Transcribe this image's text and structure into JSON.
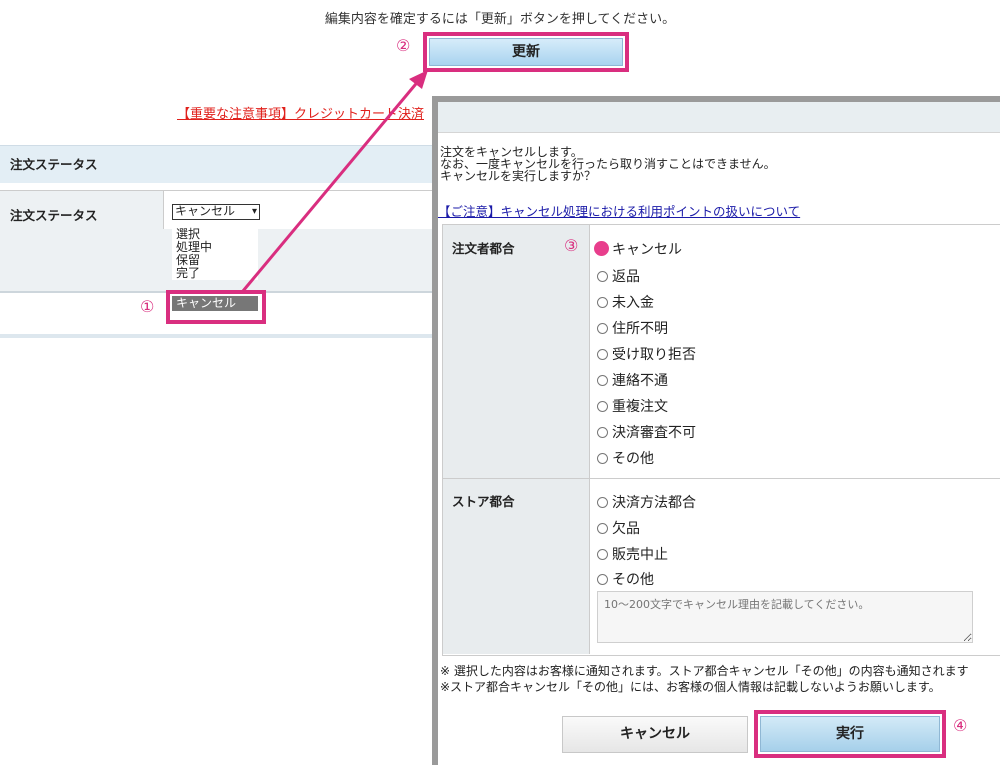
{
  "page": {
    "instruction": "編集内容を確定するには「更新」ボタンを押してください。",
    "update_button": "更新",
    "important_link": "【重要な注意事項】クレジットカード決済"
  },
  "markers": {
    "m1": "①",
    "m2": "②",
    "m3": "③",
    "m4": "④"
  },
  "order_status": {
    "section_title": "注文ステータス",
    "row_label": "注文ステータス",
    "select_value": "キャンセル",
    "options": [
      "選択",
      "処理中",
      "保留",
      "完了"
    ],
    "highlighted_option": "キャンセル"
  },
  "modal": {
    "message_lines": [
      "注文をキャンセルします。",
      "なお、一度キャンセルを行ったら取り消すことはできません。",
      "キャンセルを実行しますか？"
    ],
    "note_link": "【ご注意】キャンセル処理における利用ポイントの扱いについて",
    "customer_label": "注文者都合",
    "customer_options": [
      "キャンセル",
      "返品",
      "未入金",
      "住所不明",
      "受け取り拒否",
      "連絡不通",
      "重複注文",
      "決済審査不可",
      "その他"
    ],
    "selected_option": "キャンセル",
    "store_label": "ストア都合",
    "store_options": [
      "決済方法都合",
      "欠品",
      "販売中止",
      "その他"
    ],
    "reason_placeholder": "10～200文字でキャンセル理由を記載してください。",
    "notes": [
      "※ 選択した内容はお客様に通知されます。ストア都合キャンセル「その他」の内容も通知されます",
      "※ストア都合キャンセル「その他」には、お客様の個人情報は記載しないようお願いします。"
    ],
    "cancel_button": "キャンセル",
    "execute_button": "実行"
  },
  "colors": {
    "annotation": "#d92e7f",
    "selected_radio": "#e83e8c",
    "link": "#1a1aa8",
    "warning": "#e0201b"
  }
}
